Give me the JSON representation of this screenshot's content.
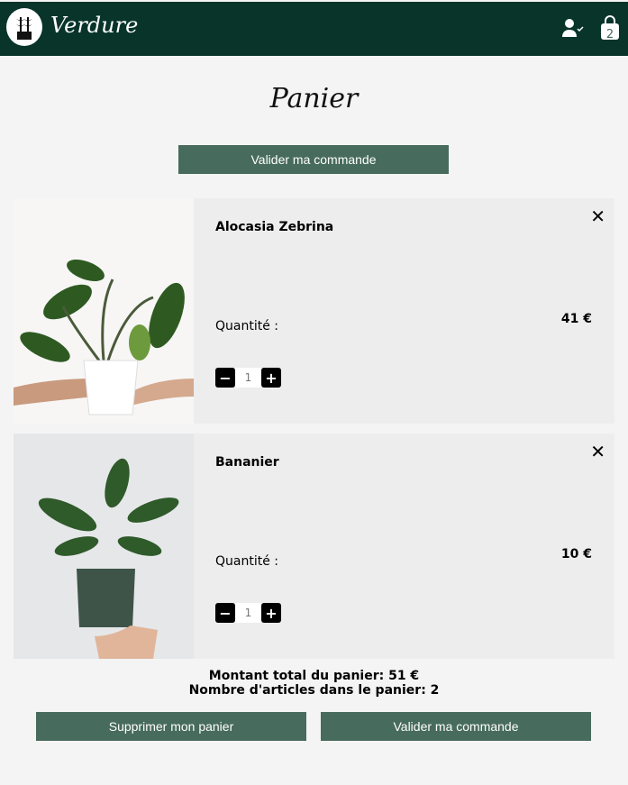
{
  "header": {
    "brand": "Verdure",
    "cart_count": "2"
  },
  "page": {
    "title": "Panier",
    "validate_top": "Valider ma commande"
  },
  "items": [
    {
      "name": "Alocasia Zebrina",
      "quantity_label": "Quantité :",
      "quantity": "1",
      "price": "41 €",
      "minus": "−",
      "plus": "+",
      "remove": "✕"
    },
    {
      "name": "Bananier",
      "quantity_label": "Quantité :",
      "quantity": "1",
      "price": "10 €",
      "minus": "−",
      "plus": "+",
      "remove": "✕"
    }
  ],
  "summary": {
    "total": "Montant total du panier: 51 €",
    "count": "Nombre d'articles dans le panier: 2"
  },
  "actions": {
    "clear": "Supprimer mon panier",
    "validate": "Valider ma commande"
  }
}
